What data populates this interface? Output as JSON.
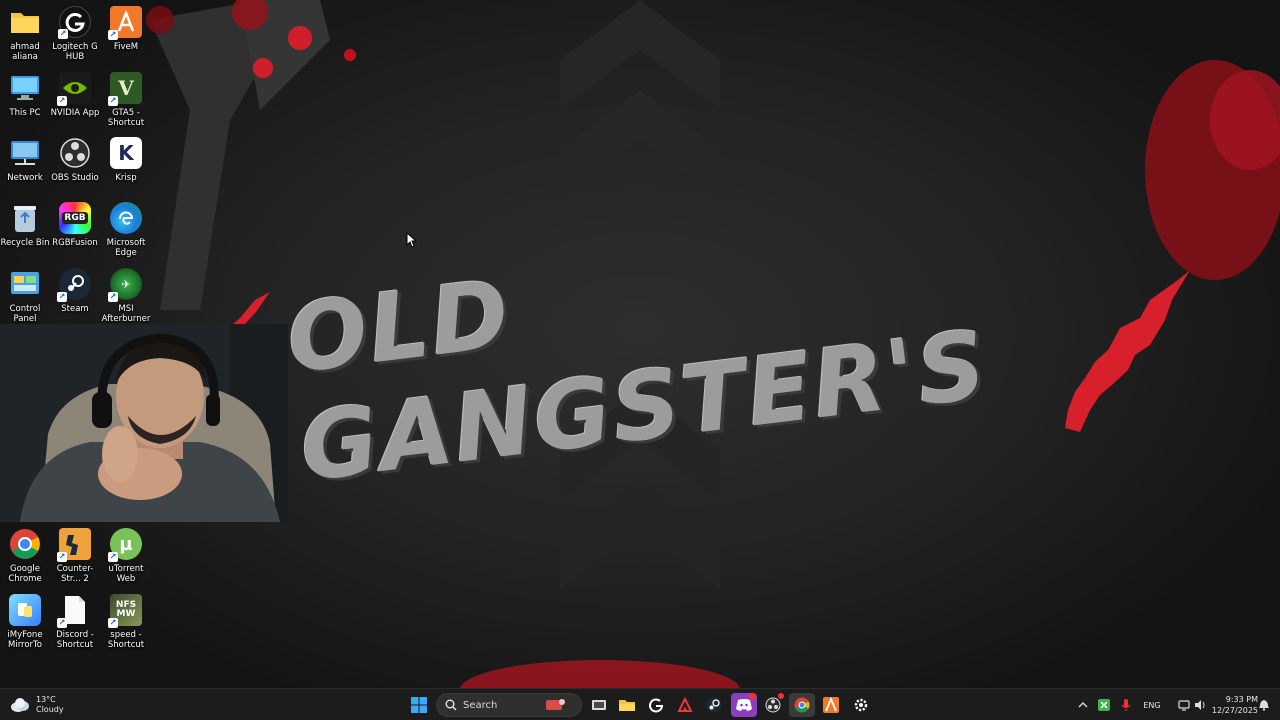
{
  "wallpaper": {
    "title": "OLD GANGSTER'S"
  },
  "desktop": {
    "icons": [
      {
        "label": "ahmad aliana",
        "icon": "folder-icon"
      },
      {
        "label": "Logitech G HUB",
        "icon": "logitech-icon"
      },
      {
        "label": "FiveM",
        "icon": "fivem-icon"
      },
      {
        "label": "This PC",
        "icon": "monitor-icon"
      },
      {
        "label": "NVIDIA App",
        "icon": "nvidia-icon"
      },
      {
        "label": "GTA5 - Shortcut",
        "icon": "gta5-icon"
      },
      {
        "label": "Network",
        "icon": "network-icon"
      },
      {
        "label": "OBS Studio",
        "icon": "obs-icon"
      },
      {
        "label": "Krisp",
        "icon": "krisp-icon"
      },
      {
        "label": "Recycle Bin",
        "icon": "recycle-bin-icon"
      },
      {
        "label": "RGBFusion",
        "icon": "rgbfusion-icon"
      },
      {
        "label": "Microsoft Edge",
        "icon": "edge-icon"
      },
      {
        "label": "Control Panel",
        "icon": "control-panel-icon"
      },
      {
        "label": "Steam",
        "icon": "steam-icon"
      },
      {
        "label": "MSI Afterburner",
        "icon": "msi-afterburner-icon"
      },
      {
        "label": "Google Chrome",
        "icon": "chrome-icon"
      },
      {
        "label": "Counter-Str... 2",
        "icon": "counter-strike-icon"
      },
      {
        "label": "uTorrent Web",
        "icon": "utorrent-icon"
      },
      {
        "label": "iMyFone MirrorTo",
        "icon": "imyfone-icon"
      },
      {
        "label": "Discord - Shortcut",
        "icon": "file-icon"
      },
      {
        "label": "speed - Shortcut",
        "icon": "nfs-icon"
      }
    ]
  },
  "taskbar": {
    "weather": {
      "temp": "13°C",
      "condition": "Cloudy"
    },
    "search": {
      "placeholder": "Search"
    },
    "tray": {
      "language": "ENG",
      "time": "9:33 PM",
      "date": "12/27/2025"
    }
  }
}
